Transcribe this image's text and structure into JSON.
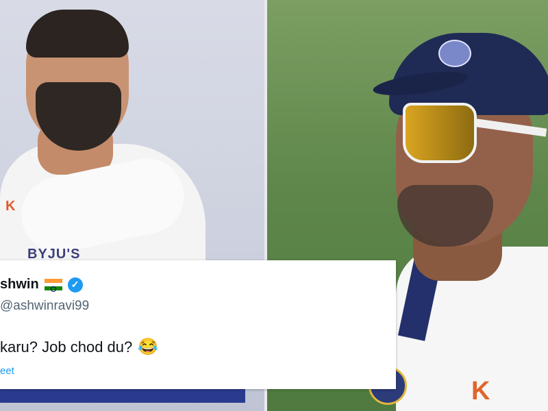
{
  "tweet": {
    "display_name": "shwin",
    "handle": "ashwinravi99",
    "text": "karu? Job chod du?",
    "link_label": "eet",
    "flag_icon": "india-flag-icon",
    "verified_icon": "verified-badge-icon",
    "emoji_icon": "face-with-tears-of-joy-icon"
  },
  "left_photo": {
    "logo_text": "BYJU'S",
    "logo_mark": "K"
  },
  "right_photo": {
    "logo_text": "K"
  },
  "colors": {
    "verified_blue": "#1d9bf0",
    "tweet_bg": "#ffffff",
    "handle_gray": "#536471"
  }
}
